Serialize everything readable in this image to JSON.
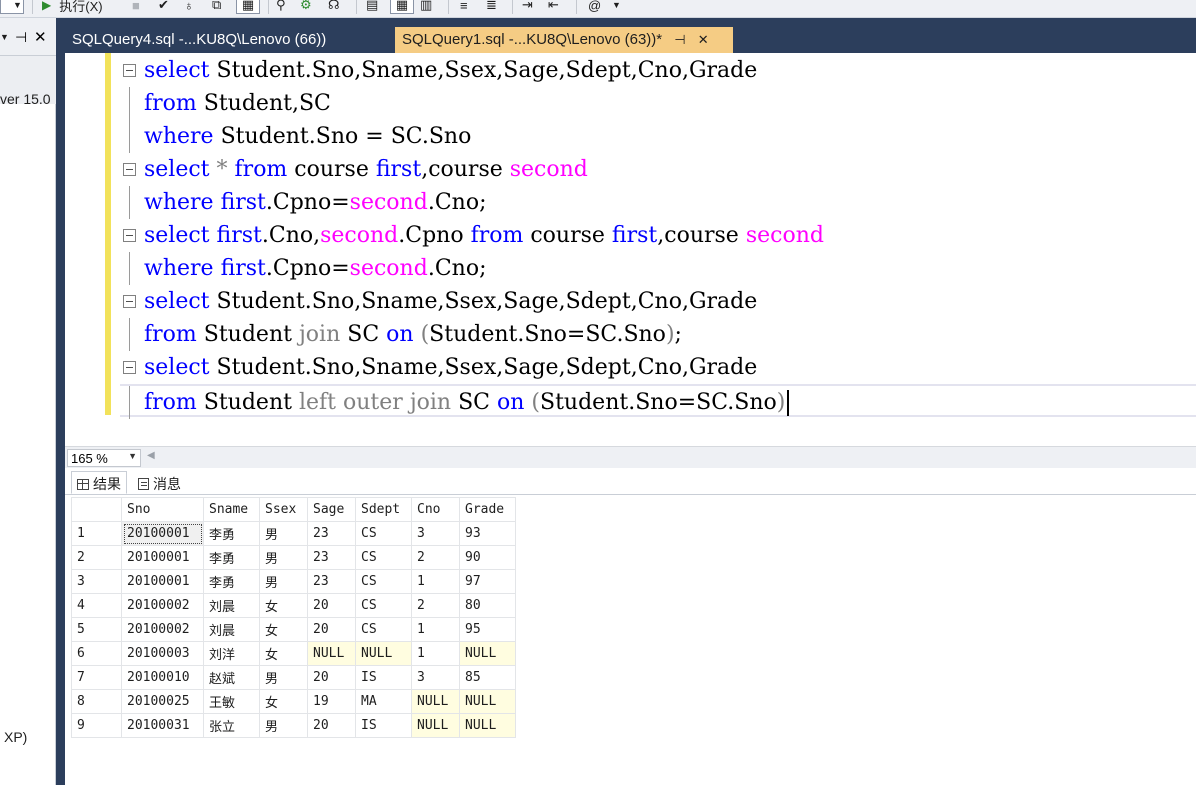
{
  "toolbar": {
    "execute_label": "执行(X)",
    "icons": [
      "dropdown-icon",
      "execute-icon",
      "stop-icon",
      "parse-check-icon",
      "query-options-icon",
      "display-plan-icon",
      "results-text-icon",
      "results-grid-icon",
      "results-file-icon",
      "comment-icon",
      "uncomment-icon",
      "indent-icon",
      "outdent-icon",
      "intellisense-icon"
    ]
  },
  "left_panel": {
    "pin_icon": "pin-icon",
    "close_icon": "close-icon",
    "server_text": "ver 15.0",
    "bottom_text": "XP)"
  },
  "tabs": [
    {
      "label": "SQLQuery4.sql -...KU8Q\\Lenovo (66))",
      "active": false
    },
    {
      "label": "SQLQuery1.sql -...KU8Q\\Lenovo (63))*",
      "active": true,
      "pin": "⊣",
      "close": "✕"
    }
  ],
  "editor": {
    "lines": [
      "select Student.Sno,Sname,Ssex,Sage,Sdept,Cno,Grade",
      "from Student,SC",
      "where Student.Sno = SC.Sno",
      "select * from course first,course second",
      "where first.Cpno=second.Cno;",
      "select first.Cno,second.Cpno from course first,course second",
      "where first.Cpno=second.Cno;",
      "select Student.Sno,Sname,Ssex,Sage,Sdept,Cno,Grade",
      "from Student join SC on (Student.Sno=SC.Sno);",
      "select Student.Sno,Sname,Ssex,Sage,Sdept,Cno,Grade",
      "from Student left outer join SC on (Student.Sno=SC.Sno)"
    ]
  },
  "zoom": {
    "value": "165 %"
  },
  "results_tabs": {
    "results": "结果",
    "messages": "消息"
  },
  "results": {
    "columns": [
      "Sno",
      "Sname",
      "Ssex",
      "Sage",
      "Sdept",
      "Cno",
      "Grade"
    ],
    "rows": [
      [
        "1",
        "20100001",
        "李勇",
        "男",
        "23",
        "CS",
        "3",
        "93"
      ],
      [
        "2",
        "20100001",
        "李勇",
        "男",
        "23",
        "CS",
        "2",
        "90"
      ],
      [
        "3",
        "20100001",
        "李勇",
        "男",
        "23",
        "CS",
        "1",
        "97"
      ],
      [
        "4",
        "20100002",
        "刘晨",
        "女",
        "20",
        "CS",
        "2",
        "80"
      ],
      [
        "5",
        "20100002",
        "刘晨",
        "女",
        "20",
        "CS",
        "1",
        "95"
      ],
      [
        "6",
        "20100003",
        "刘洋",
        "女",
        "NULL",
        "NULL",
        "1",
        "NULL"
      ],
      [
        "7",
        "20100010",
        "赵斌",
        "男",
        "20",
        "IS",
        "3",
        "85"
      ],
      [
        "8",
        "20100025",
        "王敏",
        "女",
        "19",
        "MA",
        "NULL",
        "NULL"
      ],
      [
        "9",
        "20100031",
        "张立",
        "男",
        "20",
        "IS",
        "NULL",
        "NULL"
      ]
    ]
  }
}
